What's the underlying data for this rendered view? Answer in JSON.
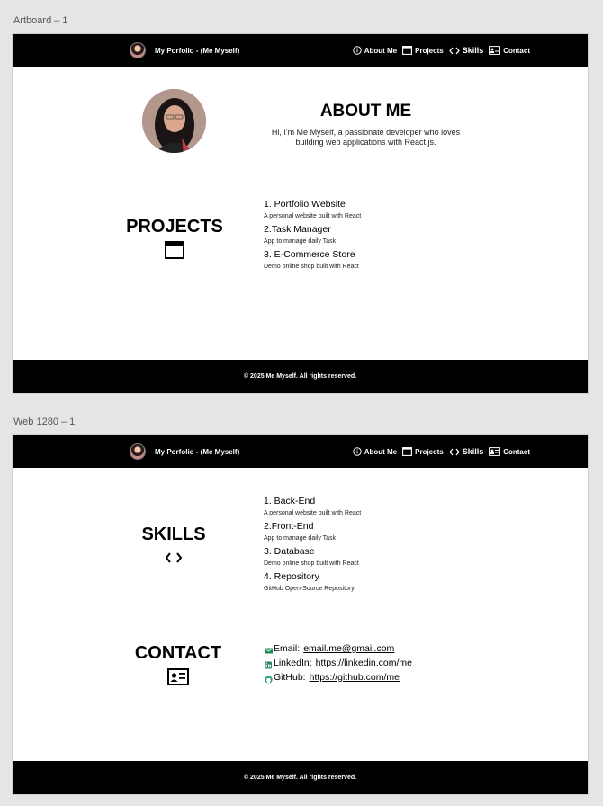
{
  "artboards": [
    {
      "label": "Artboard – 1"
    },
    {
      "label": "Web 1280 – 1"
    }
  ],
  "nav": {
    "brand": "My Porfolio - (Me Myself)",
    "items": [
      {
        "label": "About Me",
        "icon": "info-icon"
      },
      {
        "label": "Projects",
        "icon": "window-icon"
      },
      {
        "label": "Skills",
        "icon": "code-icon"
      },
      {
        "label": "Contact",
        "icon": "contact-card-icon"
      }
    ]
  },
  "about": {
    "title": "ABOUT ME",
    "body": "Hi, I'm Me Myself, a passionate developer who loves building web applications with React.js."
  },
  "projects": {
    "title": "PROJECTS",
    "items": [
      {
        "title": "1. Portfolio Website",
        "desc": "A personal website built with React"
      },
      {
        "title": "2.Task Manager",
        "desc": "App to manage daily Task"
      },
      {
        "title": "3. E-Commerce Store",
        "desc": "Demo online shop built with React"
      }
    ]
  },
  "skills": {
    "title": "SKILLS",
    "items": [
      {
        "title": "1. Back-End",
        "desc": "A personal website built with React"
      },
      {
        "title": "2.Front-End",
        "desc": "App to manage daily Task"
      },
      {
        "title": "3. Database",
        "desc": "Demo online shop built with React"
      },
      {
        "title": "4. Repository",
        "desc": "GitHub Open-Source Repository"
      }
    ]
  },
  "contact": {
    "title": "CONTACT",
    "items": [
      {
        "label": "Email:",
        "value": "email.me@gmail.com",
        "icon": "mail-icon",
        "color": "#1a8a5a"
      },
      {
        "label": "LinkedIn:",
        "value": "https://linkedin.com/me",
        "icon": "linkedin-icon",
        "color": "#2a8a6a"
      },
      {
        "label": "GitHub:",
        "value": "https://github.com/me",
        "icon": "github-icon",
        "color": "#3aa07a"
      }
    ]
  },
  "footer": {
    "text": "© 2025 Me Myself. All rights reserved."
  }
}
